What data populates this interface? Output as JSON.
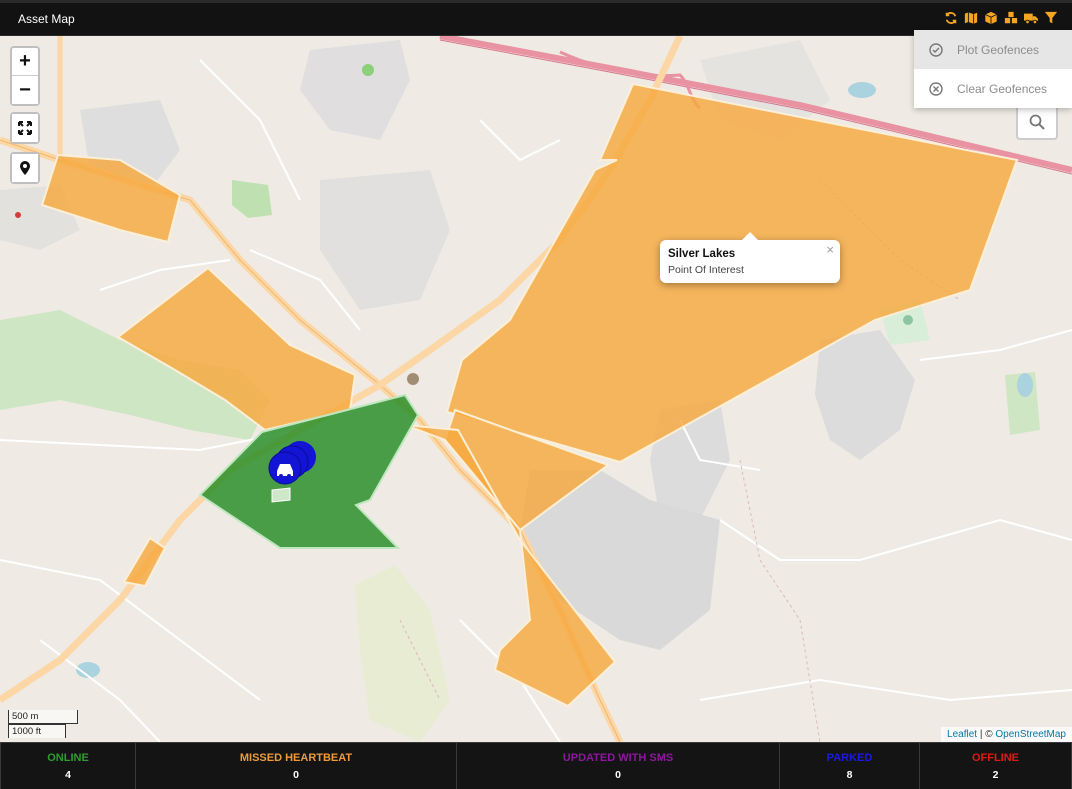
{
  "header": {
    "title": "Asset Map",
    "toolbar": [
      {
        "icon": "refresh-icon"
      },
      {
        "icon": "map-icon"
      },
      {
        "icon": "box-icon"
      },
      {
        "icon": "cubes-icon"
      },
      {
        "icon": "truck-icon"
      },
      {
        "icon": "filter-icon"
      }
    ],
    "accent": "#f4a623"
  },
  "geofence_menu": {
    "items": [
      {
        "label": "Plot Geofences",
        "icon": "check-circle-icon"
      },
      {
        "label": "Clear Geofences",
        "icon": "x-circle-icon"
      }
    ]
  },
  "map": {
    "zoom_in": "+",
    "zoom_out": "−",
    "popup": {
      "title": "Silver Lakes",
      "subtitle": "Point Of Interest",
      "close": "×"
    },
    "scale": {
      "metric": "500 m",
      "imperial": "1000 ft"
    },
    "attribution": {
      "leaflet": "Leaflet",
      "separator": " | © ",
      "osm": "OpenStreetMap"
    },
    "colors": {
      "geofence_orange": "#f7a83e",
      "geofence_green": "#2a8f2a",
      "marker": "#1414d4"
    }
  },
  "status": [
    {
      "label": "ONLINE",
      "value": "4",
      "color": "#2e9e2e"
    },
    {
      "label": "MISSED HEARTBEAT",
      "value": "0",
      "color": "#f09a3a"
    },
    {
      "label": "UPDATED WITH SMS",
      "value": "0",
      "color": "#8a1a9a"
    },
    {
      "label": "PARKED",
      "value": "8",
      "color": "#1a1ae6"
    },
    {
      "label": "OFFLINE",
      "value": "2",
      "color": "#e01919"
    }
  ]
}
